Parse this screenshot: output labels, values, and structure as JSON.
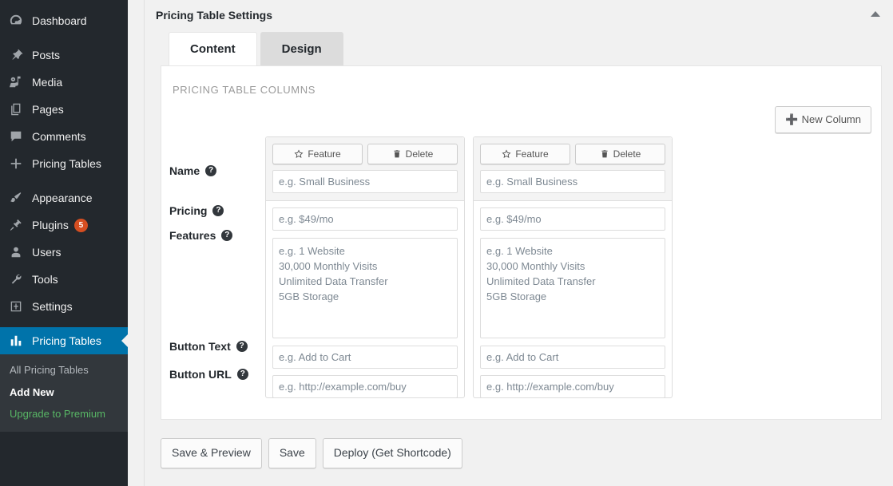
{
  "sidebar": {
    "items": [
      {
        "label": "Dashboard",
        "icon": "dashboard-icon",
        "name": "sidebar-item-dashboard"
      },
      {
        "label": "Posts",
        "icon": "pin-icon",
        "name": "sidebar-item-posts"
      },
      {
        "label": "Media",
        "icon": "media-icon",
        "name": "sidebar-item-media"
      },
      {
        "label": "Pages",
        "icon": "pages-icon",
        "name": "sidebar-item-pages"
      },
      {
        "label": "Comments",
        "icon": "comment-icon",
        "name": "sidebar-item-comments"
      },
      {
        "label": "Pricing Tables",
        "icon": "plus-icon",
        "name": "sidebar-item-pricing-tables-plus"
      },
      {
        "label": "Appearance",
        "icon": "brush-icon",
        "name": "sidebar-item-appearance"
      },
      {
        "label": "Plugins",
        "icon": "plugin-icon",
        "name": "sidebar-item-plugins",
        "badge": "5"
      },
      {
        "label": "Users",
        "icon": "user-icon",
        "name": "sidebar-item-users"
      },
      {
        "label": "Tools",
        "icon": "wrench-icon",
        "name": "sidebar-item-tools"
      },
      {
        "label": "Settings",
        "icon": "settings-icon",
        "name": "sidebar-item-settings"
      }
    ],
    "current": {
      "label": "Pricing Tables",
      "icon": "chart-bars-icon"
    },
    "submenu": [
      {
        "label": "All Pricing Tables",
        "state": "normal"
      },
      {
        "label": "Add New",
        "state": "current"
      },
      {
        "label": "Upgrade to Premium",
        "state": "upgrade"
      }
    ],
    "colors": {
      "background": "#23282d",
      "submenu_background": "#32373c",
      "active": "#0073aa",
      "badge": "#d54e21",
      "upgrade": "#58b665"
    }
  },
  "panel": {
    "title": "Pricing Table Settings",
    "toggle_icon": "caret-up-icon",
    "tabs": [
      {
        "label": "Content",
        "active": true
      },
      {
        "label": "Design",
        "active": false
      }
    ],
    "section_title": "PRICING TABLE COLUMNS",
    "new_column_label": "New Column",
    "new_column_icon": "plus-icon"
  },
  "form": {
    "labels": {
      "name": "Name",
      "pricing": "Pricing",
      "features": "Features",
      "button_text": "Button Text",
      "button_url": "Button URL"
    },
    "help_icon": "help-icon",
    "placeholders": {
      "name": "e.g. Small Business",
      "pricing": "e.g. $49/mo",
      "features": "e.g. 1 Website\n30,000 Monthly Visits\nUnlimited Data Transfer\n5GB Storage",
      "button_text": "e.g. Add to Cart",
      "button_url": "e.g. http://example.com/buy"
    },
    "values": {
      "name": "",
      "pricing": "",
      "features": "",
      "button_text": "",
      "button_url": ""
    },
    "card_buttons": {
      "feature": "Feature",
      "feature_icon": "star-icon",
      "delete": "Delete",
      "delete_icon": "trash-icon"
    },
    "columns": [
      {
        "index": 1
      },
      {
        "index": 2
      }
    ]
  },
  "footer": {
    "buttons": [
      {
        "label": "Save & Preview",
        "name": "save-and-preview-button"
      },
      {
        "label": "Save",
        "name": "save-button"
      },
      {
        "label": "Deploy (Get Shortcode)",
        "name": "deploy-shortcode-button"
      }
    ]
  }
}
